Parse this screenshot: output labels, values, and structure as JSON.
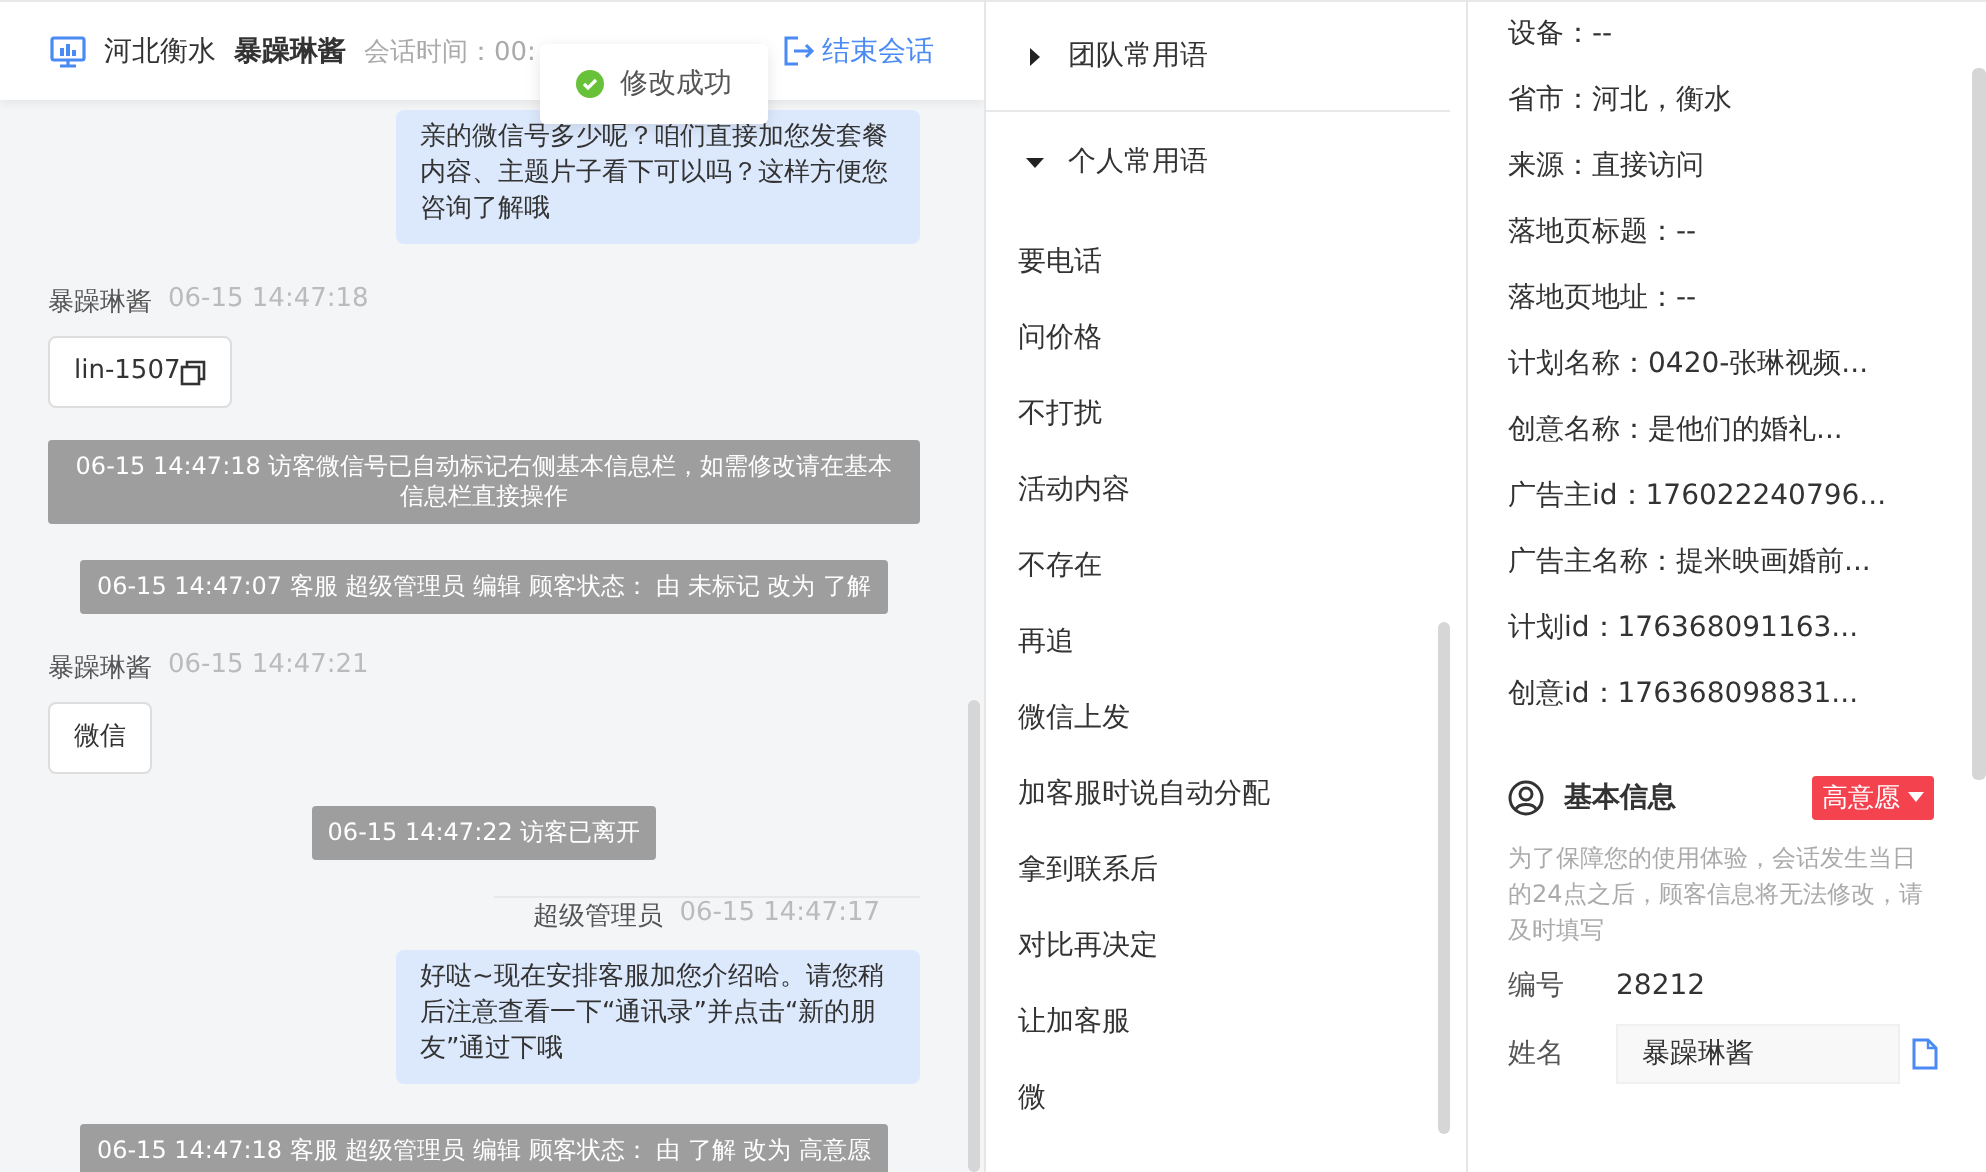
{
  "header": {
    "location": "河北衡水",
    "customer": "暴躁琳酱",
    "session_time": "会话时间：00:",
    "end_button": "结束会话"
  },
  "toast": {
    "text": "修改成功"
  },
  "messages": [
    {
      "kind": "agent",
      "text": "亲的微信号多少呢？咱们直接加您发套餐内容、主题片子看下可以吗？这样方便您咨询了解哦"
    },
    {
      "kind": "customer",
      "name": "暴躁琳酱",
      "time": "06-15 14:47:18",
      "text": "lin-1507",
      "copy": true
    },
    {
      "kind": "system",
      "text": "06-15 14:47:18 访客微信号已自动标记右侧基本信息栏，如需修改请在基本信息栏直接操作"
    },
    {
      "kind": "system",
      "text": "06-15 14:47:07 客服 超级管理员 编辑 顾客状态： 由 未标记 改为 了解"
    },
    {
      "kind": "customer",
      "name": "暴躁琳酱",
      "time": "06-15 14:47:21",
      "text": "微信",
      "copy": false
    },
    {
      "kind": "system",
      "text": "06-15 14:47:22 访客已离开"
    },
    {
      "kind": "agent",
      "name": "超级管理员",
      "time": "06-15 14:47:17",
      "text": "好哒~现在安排客服加您介绍哈。请您稍后注意查看一下“通讯录”并点击“新的朋友”通过下哦"
    },
    {
      "kind": "system",
      "text": "06-15 14:47:18 客服 超级管理员 编辑 顾客状态： 由 了解 改为 高意愿"
    }
  ],
  "phrases": {
    "groups": [
      {
        "title": "团队常用语",
        "expanded": false
      },
      {
        "title": "个人常用语",
        "expanded": true
      }
    ],
    "items": [
      "要电话",
      "问价格",
      "不打扰",
      "活动内容",
      "不存在",
      "再追",
      "微信上发",
      "加客服时说自动分配",
      "拿到联系后",
      "对比再决定",
      "让加客服",
      "微"
    ]
  },
  "info": {
    "fields": [
      "设备：--",
      "省市：河北，衡水",
      "来源：直接访问",
      "落地页标题：--",
      "落地页地址：--",
      "计划名称：0420-张琳视频...",
      "创意名称：是他们的婚礼...",
      "广告主id：176022240796...",
      "广告主名称：提米映画婚前...",
      "计划id：176368091163...",
      "创意id：176368098831..."
    ],
    "basic": {
      "title": "基本信息",
      "status": "高意愿",
      "notice": "为了保障您的使用体验，会话发生当日的24点之后，顾客信息将无法修改，请及时填写",
      "id_label": "编号",
      "id_value": "28212",
      "name_label": "姓名",
      "name_value": "暴躁琳酱"
    }
  }
}
